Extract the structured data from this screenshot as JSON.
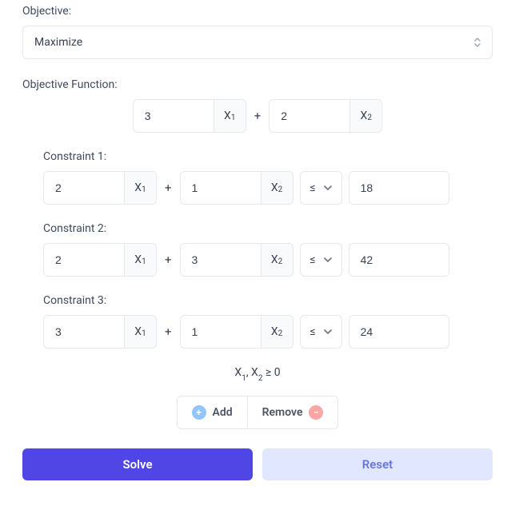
{
  "objective": {
    "label": "Objective:",
    "selected": "Maximize"
  },
  "objective_function": {
    "label": "Objective Function:",
    "coeffs": [
      "3",
      "2"
    ],
    "vars": [
      "X1",
      "X2"
    ]
  },
  "constraints": [
    {
      "label": "Constraint 1:",
      "coeffs": [
        "2",
        "1"
      ],
      "vars": [
        "X1",
        "X2"
      ],
      "op": "≤",
      "rhs": "18"
    },
    {
      "label": "Constraint 2:",
      "coeffs": [
        "2",
        "3"
      ],
      "vars": [
        "X1",
        "X2"
      ],
      "op": "≤",
      "rhs": "42"
    },
    {
      "label": "Constraint 3:",
      "coeffs": [
        "3",
        "1"
      ],
      "vars": [
        "X1",
        "X2"
      ],
      "op": "≤",
      "rhs": "24"
    }
  ],
  "nonneg": "X1, X2 ≥ 0",
  "buttons": {
    "add": "Add",
    "remove": "Remove",
    "solve": "Solve",
    "reset": "Reset"
  },
  "plus": "+"
}
